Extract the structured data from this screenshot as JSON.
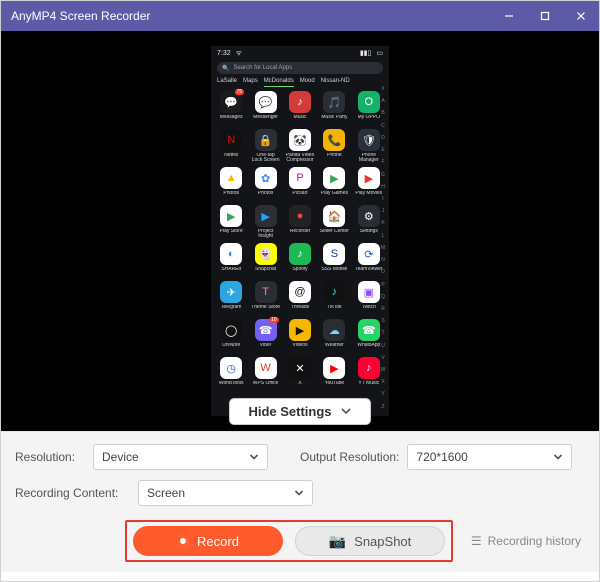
{
  "title": "AnyMP4 Screen Recorder",
  "phone": {
    "time": "7:32",
    "search_placeholder": "Search for Local Apps",
    "tabs": [
      "LaSalle",
      "Maps",
      "McDonalds",
      "Mood",
      "Nissan-ND"
    ],
    "active_tab_index": 2,
    "apps": [
      {
        "label": "Messages",
        "bg": "#1b1b1b",
        "glyph": "💬",
        "badge": "75"
      },
      {
        "label": "Messenger",
        "bg": "#ffffff",
        "glyph": "💬",
        "fg": "#7b37ff"
      },
      {
        "label": "Music",
        "bg": "#d33a3a",
        "glyph": "♪"
      },
      {
        "label": "Music Party",
        "bg": "#2a2e34",
        "glyph": "🎵"
      },
      {
        "label": "My OPPO",
        "bg": "#15b36a",
        "glyph": "O"
      },
      {
        "label": "Netflix",
        "bg": "#111",
        "glyph": "N",
        "fg": "#e50914"
      },
      {
        "label": "One-tap Lock Screen",
        "bg": "#2b2f36",
        "glyph": "🔒"
      },
      {
        "label": "Panda Video Compressor",
        "bg": "#ffffff",
        "glyph": "🐼",
        "fg": "#111"
      },
      {
        "label": "Phone",
        "bg": "#f4b400",
        "glyph": "📞"
      },
      {
        "label": "Phone Manager",
        "bg": "#28313b",
        "glyph": "🛡"
      },
      {
        "label": "Photos",
        "bg": "#fff",
        "glyph": "▲",
        "fg": "#f5b700"
      },
      {
        "label": "Photos",
        "bg": "#fff",
        "glyph": "✿",
        "fg": "#4285f4"
      },
      {
        "label": "Picsart",
        "bg": "#fff",
        "glyph": "P",
        "fg": "#c40ea1"
      },
      {
        "label": "Play Games",
        "bg": "#fff",
        "glyph": "▶",
        "fg": "#34a853"
      },
      {
        "label": "Play Movies",
        "bg": "#fff",
        "glyph": "▶",
        "fg": "#e8352e"
      },
      {
        "label": "Play Store",
        "bg": "#fff",
        "glyph": "▶",
        "fg": "#34a853"
      },
      {
        "label": "Project Insight",
        "bg": "#2d2f33",
        "glyph": "▶",
        "fg": "#1ea4ff"
      },
      {
        "label": "Recorder",
        "bg": "#232323",
        "glyph": "●",
        "fg": "#ff4040"
      },
      {
        "label": "Seller Center",
        "bg": "#fff",
        "glyph": "🏠",
        "fg": "#ff7a00"
      },
      {
        "label": "Settings",
        "bg": "#2a2e34",
        "glyph": "⚙"
      },
      {
        "label": "SHAREit",
        "bg": "#fff",
        "glyph": "◐",
        "fg": "#1893e6"
      },
      {
        "label": "Snapchat",
        "bg": "#fffc00",
        "glyph": "👻",
        "fg": "#fff"
      },
      {
        "label": "Spotify",
        "bg": "#1db954",
        "glyph": "♪"
      },
      {
        "label": "SSS Mobile",
        "bg": "#fff",
        "glyph": "S",
        "fg": "#0a3f8f"
      },
      {
        "label": "TeamViewer",
        "bg": "#fff",
        "glyph": "⟳",
        "fg": "#0b66c3"
      },
      {
        "label": "Telegram",
        "bg": "#2ca5e0",
        "glyph": "✈"
      },
      {
        "label": "Theme Store",
        "bg": "#2a2e34",
        "glyph": "T",
        "fg": "#ff78b1"
      },
      {
        "label": "Threads",
        "bg": "#fff",
        "glyph": "@",
        "fg": "#111"
      },
      {
        "label": "TikTok",
        "bg": "#111",
        "glyph": "♪",
        "fg": "#25f4ee"
      },
      {
        "label": "Twitch",
        "bg": "#fff",
        "glyph": "▣",
        "fg": "#9146ff"
      },
      {
        "label": "UniNote",
        "bg": "#111",
        "glyph": "◯"
      },
      {
        "label": "Viber",
        "bg": "#7360f2",
        "glyph": "☎",
        "badge": "10"
      },
      {
        "label": "Videos",
        "bg": "#f5b700",
        "glyph": "▶",
        "fg": "#111"
      },
      {
        "label": "Weather",
        "bg": "#2a2e34",
        "glyph": "☁",
        "fg": "#7dd3ff"
      },
      {
        "label": "WhatsApp",
        "bg": "#25d366",
        "glyph": "☎"
      },
      {
        "label": "WorldTools",
        "bg": "#fff",
        "glyph": "◷",
        "fg": "#145a9e"
      },
      {
        "label": "WPS Office",
        "bg": "#fff",
        "glyph": "W",
        "fg": "#e03a2f"
      },
      {
        "label": "X",
        "bg": "#111",
        "glyph": "✕"
      },
      {
        "label": "YouTube",
        "bg": "#fff",
        "glyph": "▶",
        "fg": "#ff0000"
      },
      {
        "label": "YT Music",
        "bg": "#ff0033",
        "glyph": "♪"
      }
    ],
    "alphabet": [
      "#",
      "A",
      "B",
      "C",
      "D",
      "E",
      "F",
      "G",
      "H",
      "I",
      "J",
      "K",
      "L",
      "M",
      "N",
      "O",
      "P",
      "Q",
      "R",
      "S",
      "T",
      "U",
      "V",
      "W",
      "X",
      "Y",
      "Z"
    ]
  },
  "hide_settings_label": "Hide Settings",
  "settings": {
    "resolution_label": "Resolution:",
    "resolution_value": "Device",
    "output_label": "Output Resolution:",
    "output_value": "720*1600",
    "content_label": "Recording Content:",
    "content_value": "Screen"
  },
  "actions": {
    "record": "Record",
    "snapshot": "SnapShot",
    "history": "Recording history"
  }
}
